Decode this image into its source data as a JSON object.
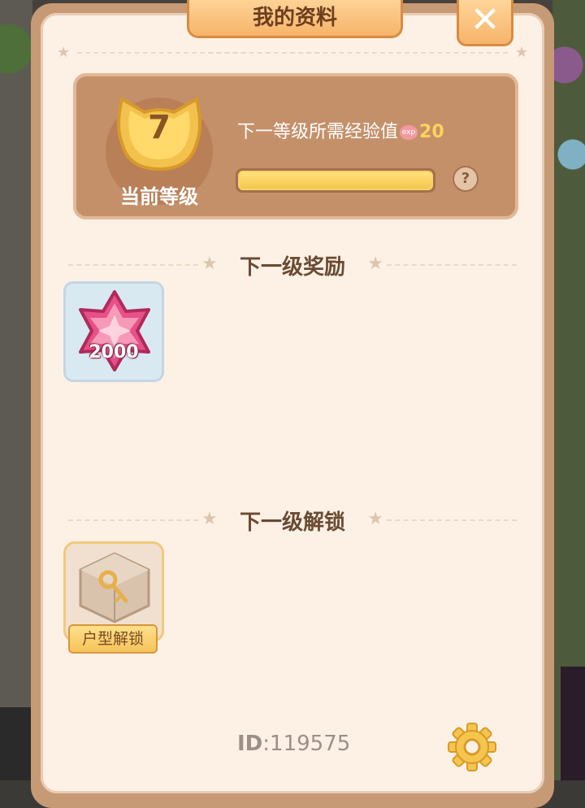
{
  "panel": {
    "title": "我的资料",
    "close_label": "✕"
  },
  "level": {
    "value": "7",
    "label": "当前等级",
    "exp_text": "下一等级所需经验值",
    "exp_icon": "exp",
    "exp_required": "20",
    "exp_progress": 1.0,
    "help_label": "?"
  },
  "reward_section": {
    "title": "下一级奖励",
    "items": [
      {
        "icon": "pink-star-gem-icon",
        "count": "2000"
      }
    ]
  },
  "unlock_section": {
    "title": "下一级解锁",
    "items": [
      {
        "icon": "key-box-icon",
        "label": "户型解锁"
      }
    ]
  },
  "footer": {
    "id_prefix": "ID",
    "id_value": ":119575"
  },
  "colors": {
    "panel_bg": "#fdf1e6",
    "panel_border": "#c79a76",
    "accent_orange": "#f6b46a",
    "level_card": "#c4906a",
    "exp_fill": "#f4c64d",
    "gem_pink": "#e8508a",
    "settings_yellow": "#f4c64d"
  }
}
